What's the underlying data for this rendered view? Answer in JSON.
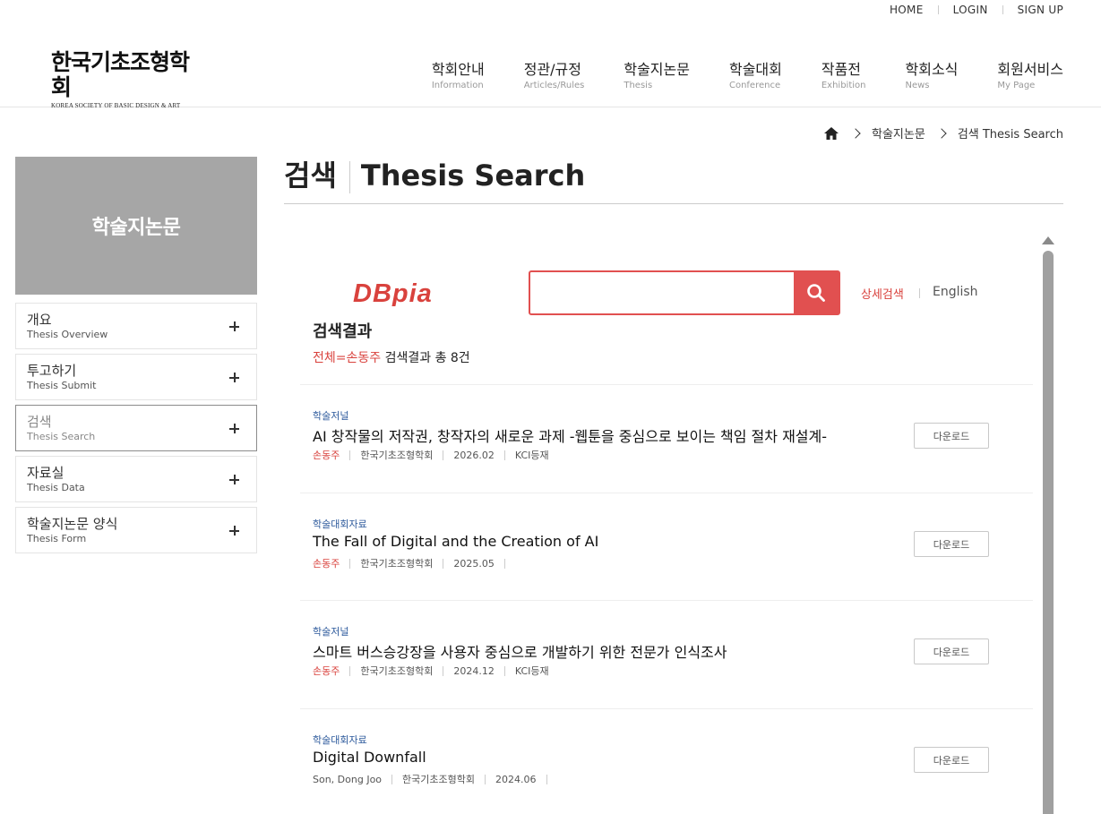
{
  "util_nav": [
    "HOME",
    "LOGIN",
    "SIGN UP"
  ],
  "logo": {
    "title": "한국기초조형학회",
    "subtitle": "KOREA SOCIETY OF BASIC DESIGN & ART"
  },
  "gnb": [
    {
      "ko": "학회안내",
      "en": "Information"
    },
    {
      "ko": "정관/규정",
      "en": "Articles/Rules"
    },
    {
      "ko": "학술지논문",
      "en": "Thesis"
    },
    {
      "ko": "학술대회",
      "en": "Conference"
    },
    {
      "ko": "작품전",
      "en": "Exhibition"
    },
    {
      "ko": "학회소식",
      "en": "News"
    },
    {
      "ko": "회원서비스",
      "en": "My Page"
    }
  ],
  "breadcrumb": [
    "학술지논문",
    "검색 Thesis Search"
  ],
  "sidebar": {
    "title": "학술지논문",
    "items": [
      {
        "ko": "개요",
        "en": "Thesis Overview",
        "active": false
      },
      {
        "ko": "투고하기",
        "en": "Thesis Submit",
        "active": false
      },
      {
        "ko": "검색",
        "en": "Thesis Search",
        "active": true
      },
      {
        "ko": "자료실",
        "en": "Thesis Data",
        "active": false
      },
      {
        "ko": "학술지논문 양식",
        "en": "Thesis Form",
        "active": false
      }
    ]
  },
  "page_title": {
    "ko": "검색",
    "en": "Thesis Search"
  },
  "search": {
    "brand": "DBpia",
    "value": "",
    "advanced_label": "상세검색",
    "english_label": "English"
  },
  "results": {
    "heading": "검색결과",
    "query": "전체=손동주",
    "summary": "검색결과 총 8건",
    "download_label": "다운로드",
    "items": [
      {
        "type": "학술저널",
        "title": "AI 창작물의 저작권, 창작자의 새로운 과제 -웹툰을 중심으로 보이는 책임 절차 재설계-",
        "author": "손동주",
        "publisher": "한국기초조형학회",
        "date": "2026.02",
        "flag": "KCI등재"
      },
      {
        "type": "학술대회자료",
        "title": "The Fall of Digital and the Creation of AI",
        "author": "손동주",
        "publisher": "한국기초조형학회",
        "date": "2025.05",
        "flag": ""
      },
      {
        "type": "학술저널",
        "title": "스마트 버스승강장을 사용자 중심으로 개발하기 위한 전문가 인식조사",
        "author": "손동주",
        "publisher": "한국기초조형학회",
        "date": "2024.12",
        "flag": "KCI등재"
      },
      {
        "type": "학술대회자료",
        "title": "Digital Downfall",
        "author": "Son, Dong Joo",
        "publisher": "한국기초조형학회",
        "date": "2024.06",
        "flag": ""
      }
    ]
  }
}
